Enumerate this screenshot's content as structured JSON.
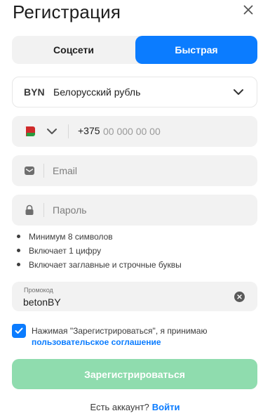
{
  "header": {
    "title": "Регистрация",
    "close_icon": "close-icon"
  },
  "tabs": [
    {
      "label": "Соцсети",
      "active": false
    },
    {
      "label": "Быстрая",
      "active": true
    }
  ],
  "currency": {
    "code": "BYN",
    "name": "Белорусский рубль"
  },
  "phone": {
    "country_flag": "Belarus",
    "code": "+375",
    "placeholder": "00 000 00 00"
  },
  "email": {
    "placeholder": "Email",
    "icon": "envelope-icon"
  },
  "password": {
    "placeholder": "Пароль",
    "icon": "lock-icon"
  },
  "password_rules": [
    "Минимум 8 символов",
    "Включает 1 цифру",
    "Включает заглавные и строчные буквы"
  ],
  "promo": {
    "label": "Промокод",
    "value": "betonBY"
  },
  "agreement": {
    "checked": true,
    "text": "Нажимая \"Зарегистрироваться\", я принимаю",
    "link": "пользовательское соглашение"
  },
  "submit_label": "Зарегистрироваться",
  "footer": {
    "question": "Есть аккаунт?",
    "login_link": "Войти"
  },
  "colors": {
    "accent": "#0b7cff",
    "submit_disabled": "#8fdcae",
    "field_bg": "#f2f2f2"
  }
}
